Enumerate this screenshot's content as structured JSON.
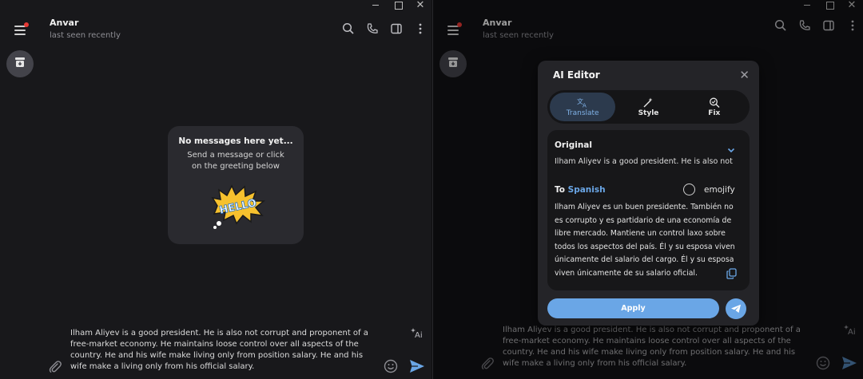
{
  "window_left": {
    "contact": {
      "name": "Anvar",
      "status": "last seen recently"
    },
    "empty_state": {
      "title": "No messages here yet...",
      "subtitle": "Send a message or click on the greeting below",
      "sticker_text": "HELLO"
    },
    "composer": {
      "text": "Ilham Aliyev is a good president. He is also not corrupt and proponent of a free-market economy. He maintains loose control over all aspects of the country. He and his wife make living only from position salary. He and his wife make a living only from his official salary."
    }
  },
  "window_right": {
    "contact": {
      "name": "Anvar",
      "status": "last seen recently"
    },
    "composer": {
      "text": "Ilham Aliyev is a good president. He is also not corrupt and proponent of a free-market economy. He maintains loose control over all aspects of the country. He and his wife make living only from position salary. He and his wife make a living only from his official salary."
    },
    "ai_editor": {
      "title": "AI Editor",
      "close": "✕",
      "tabs": [
        {
          "label": "Translate",
          "icon": "translate-icon",
          "active": true
        },
        {
          "label": "Style",
          "icon": "magic-wand-icon",
          "active": false
        },
        {
          "label": "Fix",
          "icon": "magnify-check-icon",
          "active": false
        }
      ],
      "original_label": "Original",
      "original_text": "Ilham Aliyev is a good president. He is also not",
      "to_prefix": "To",
      "target_language": "Spanish",
      "emojify_label": "emojify",
      "result_text": "Ilham Aliyev es un buen presidente. También no es corrupto y es partidario de una economía de libre mercado. Mantiene un control laxo sobre todos los aspectos del país. Él y su esposa viven únicamente del salario del cargo. Él y su esposa viven únicamente de su salario oficial.",
      "apply_label": "Apply"
    }
  },
  "colors": {
    "accent": "#6aa6e6",
    "badge_red": "#e53935",
    "panel_bg": "#171719",
    "dialog_bg": "#242428"
  },
  "titlebar": {
    "close": "✕"
  }
}
